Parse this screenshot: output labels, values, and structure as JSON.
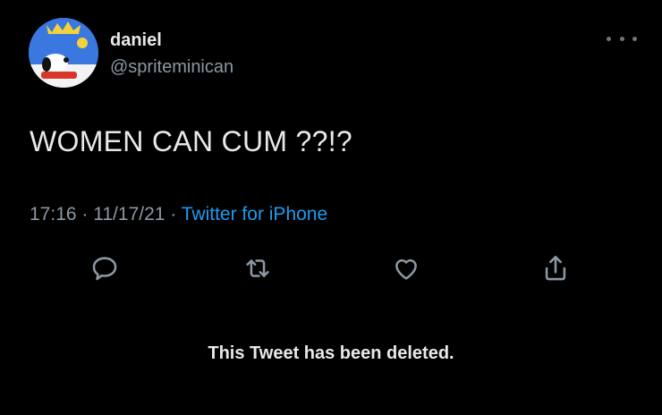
{
  "user": {
    "display_name": "daniel",
    "handle": "@spriteminican",
    "avatar_icon": "snoopy-avatar-icon"
  },
  "tweet": {
    "text": "WOMEN CAN CUM ??!?",
    "time": "17:16",
    "date": "11/17/21",
    "source": "Twitter for iPhone",
    "separator": "·"
  },
  "actions": {
    "reply_icon": "reply-icon",
    "retweet_icon": "retweet-icon",
    "like_icon": "heart-icon",
    "share_icon": "share-icon"
  },
  "status": {
    "deleted_text": "This Tweet has been deleted."
  },
  "colors": {
    "background": "#000000",
    "text": "#e7e9ea",
    "muted": "#8b98a5",
    "link": "#1d9bf0"
  }
}
